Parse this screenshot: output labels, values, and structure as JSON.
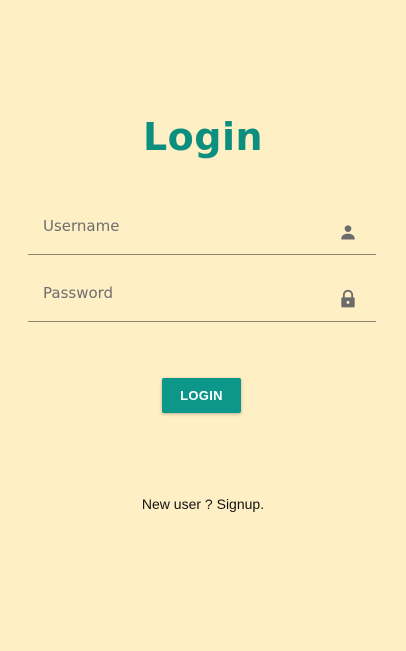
{
  "page": {
    "title": "Login"
  },
  "form": {
    "username": {
      "placeholder": "Username",
      "value": "",
      "icon": "person-icon"
    },
    "password": {
      "placeholder": "Password",
      "value": "",
      "icon": "lock-icon"
    },
    "login_label": "LOGIN"
  },
  "signup": {
    "prompt": "New user ? ",
    "link_label": "Signup",
    "suffix": "."
  },
  "colors": {
    "background": "#FFEFC4",
    "accent": "#0D968A",
    "title": "#0D8F80",
    "icon": "#6B6B6B",
    "underline": "#8F8670"
  }
}
